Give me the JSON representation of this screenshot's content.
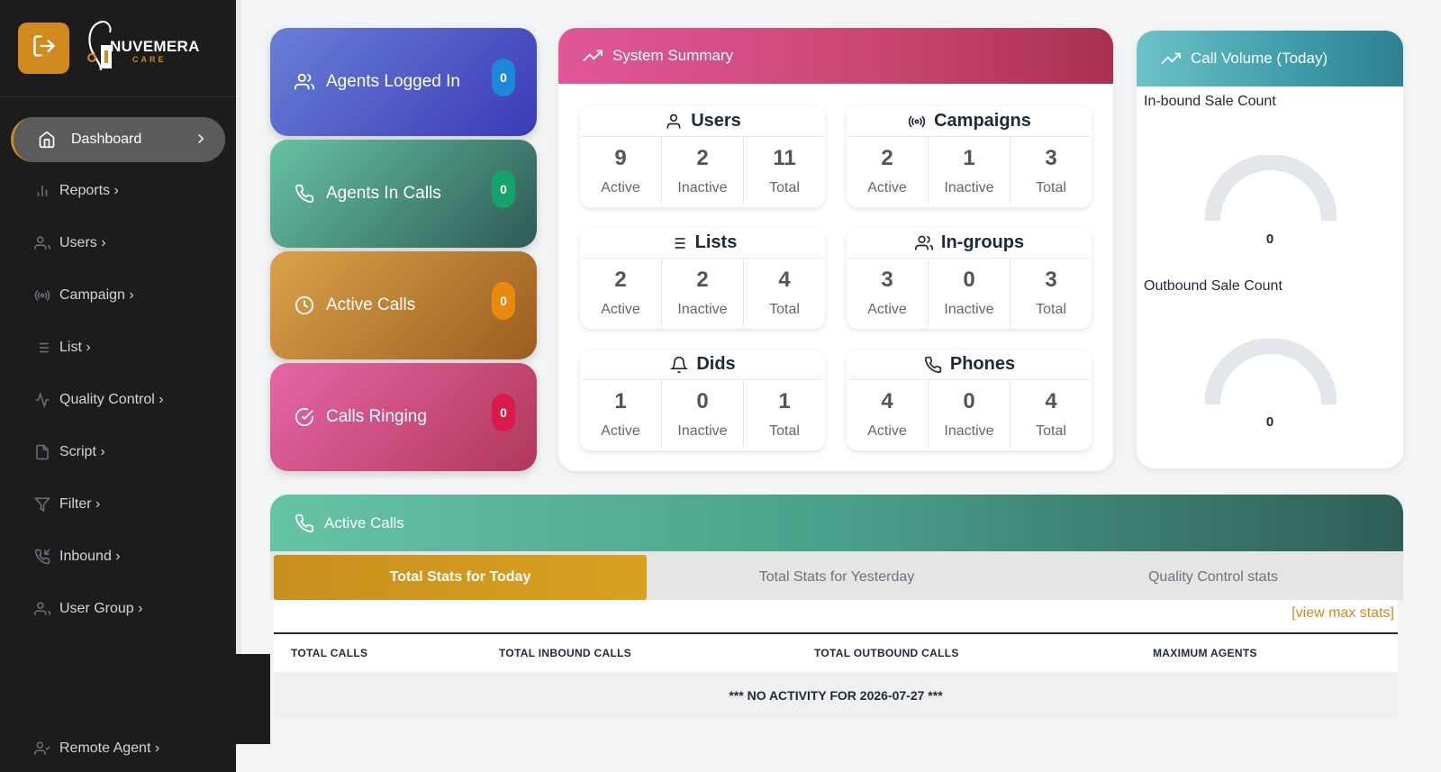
{
  "brand": {
    "name": "NUVEMERA",
    "sub": "CARE"
  },
  "sidebar": {
    "active": {
      "label": "Dashboard"
    },
    "items": [
      {
        "label": "Reports ›",
        "icon": "bar-chart-icon"
      },
      {
        "label": "Users ›",
        "icon": "users-icon"
      },
      {
        "label": "Campaign ›",
        "icon": "broadcast-icon"
      },
      {
        "label": "List ›",
        "icon": "list-icon"
      },
      {
        "label": "Quality Control ›",
        "icon": "activity-icon"
      },
      {
        "label": "Script ›",
        "icon": "file-icon"
      },
      {
        "label": "Filter ›",
        "icon": "filter-icon"
      },
      {
        "label": "Inbound ›",
        "icon": "phone-incoming-icon"
      },
      {
        "label": "User Group ›",
        "icon": "users-icon"
      },
      {
        "label": "Remote Agent ›",
        "icon": "user-check-icon"
      }
    ]
  },
  "cards": {
    "agents_logged_in": {
      "label": "Agents Logged In",
      "count": "0"
    },
    "agents_in_calls": {
      "label": "Agents In Calls",
      "count": "0"
    },
    "active_calls": {
      "label": "Active Calls",
      "count": "0"
    },
    "calls_ringing": {
      "label": "Calls Ringing",
      "count": "0"
    }
  },
  "summary": {
    "title": "System Summary",
    "labels": {
      "active": "Active",
      "inactive": "Inactive",
      "total": "Total"
    },
    "users": {
      "title": "Users",
      "active": "9",
      "inactive": "2",
      "total": "11"
    },
    "campaigns": {
      "title": "Campaigns",
      "active": "2",
      "inactive": "1",
      "total": "3"
    },
    "lists": {
      "title": "Lists",
      "active": "2",
      "inactive": "2",
      "total": "4"
    },
    "ingroups": {
      "title": "In-groups",
      "active": "3",
      "inactive": "0",
      "total": "3"
    },
    "dids": {
      "title": "Dids",
      "active": "1",
      "inactive": "0",
      "total": "1"
    },
    "phones": {
      "title": "Phones",
      "active": "4",
      "inactive": "0",
      "total": "4"
    }
  },
  "volume": {
    "title": "Call Volume (Today)",
    "inbound": {
      "label": "In-bound Sale Count",
      "value": "0"
    },
    "outbound": {
      "label": "Outbound Sale Count",
      "value": "0"
    }
  },
  "active_calls_panel": {
    "title": "Active Calls",
    "tabs": [
      "Total Stats for Today",
      "Total Stats for Yesterday",
      "Quality Control stats"
    ],
    "view_max": "[view max stats]",
    "columns": [
      "TOTAL CALLS",
      "TOTAL INBOUND CALLS",
      "TOTAL OUTBOUND CALLS",
      "MAXIMUM AGENTS"
    ],
    "empty_message": "*** NO ACTIVITY FOR 2026-07-27 ***"
  },
  "colors": {
    "accent": "#d08a1e",
    "card_blue": "#4a50c8",
    "card_green": "#3f9a86",
    "card_orange": "#c98a35",
    "card_pink": "#d9508c"
  }
}
